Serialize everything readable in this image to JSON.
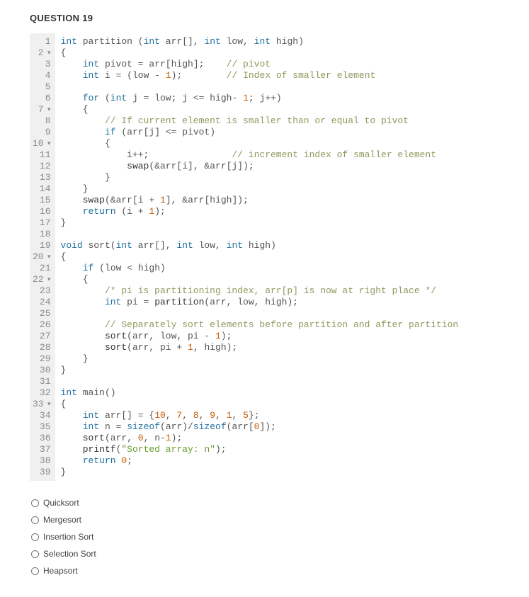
{
  "question": {
    "title": "QUESTION 19"
  },
  "code": {
    "lines": [
      {
        "n": "1",
        "fold": "",
        "tokens": [
          [
            "kw",
            "int"
          ],
          [
            "id",
            " partition "
          ],
          [
            "op",
            "("
          ],
          [
            "kw",
            "int"
          ],
          [
            "id",
            " arr"
          ],
          [
            "op",
            "[], "
          ],
          [
            "kw",
            "int"
          ],
          [
            "id",
            " low"
          ],
          [
            "op",
            ", "
          ],
          [
            "kw",
            "int"
          ],
          [
            "id",
            " high"
          ],
          [
            "op",
            ")"
          ]
        ]
      },
      {
        "n": "2",
        "fold": "▾",
        "tokens": [
          [
            "op",
            "{"
          ]
        ]
      },
      {
        "n": "3",
        "fold": "",
        "tokens": [
          [
            "id",
            "    "
          ],
          [
            "kw",
            "int"
          ],
          [
            "id",
            " pivot "
          ],
          [
            "op",
            "="
          ],
          [
            "id",
            " arr"
          ],
          [
            "op",
            "["
          ],
          [
            "id",
            "high"
          ],
          [
            "op",
            "];    "
          ],
          [
            "cmt",
            "// pivot"
          ]
        ]
      },
      {
        "n": "4",
        "fold": "",
        "tokens": [
          [
            "id",
            "    "
          ],
          [
            "kw",
            "int"
          ],
          [
            "id",
            " i "
          ],
          [
            "op",
            "="
          ],
          [
            "id",
            " "
          ],
          [
            "op",
            "("
          ],
          [
            "id",
            "low "
          ],
          [
            "op",
            "-"
          ],
          [
            "id",
            " "
          ],
          [
            "num",
            "1"
          ],
          [
            "op",
            ");        "
          ],
          [
            "cmt",
            "// Index of smaller element"
          ]
        ]
      },
      {
        "n": "5",
        "fold": "",
        "tokens": []
      },
      {
        "n": "6",
        "fold": "",
        "tokens": [
          [
            "id",
            "    "
          ],
          [
            "kw",
            "for"
          ],
          [
            "id",
            " "
          ],
          [
            "op",
            "("
          ],
          [
            "kw",
            "int"
          ],
          [
            "id",
            " j "
          ],
          [
            "op",
            "="
          ],
          [
            "id",
            " low"
          ],
          [
            "op",
            ";"
          ],
          [
            "id",
            " j "
          ],
          [
            "op",
            "<="
          ],
          [
            "id",
            " high"
          ],
          [
            "op",
            "-"
          ],
          [
            "id",
            " "
          ],
          [
            "num",
            "1"
          ],
          [
            "op",
            ";"
          ],
          [
            "id",
            " j"
          ],
          [
            "op",
            "++)"
          ]
        ]
      },
      {
        "n": "7",
        "fold": "▾",
        "tokens": [
          [
            "id",
            "    "
          ],
          [
            "op",
            "{"
          ]
        ]
      },
      {
        "n": "8",
        "fold": "",
        "tokens": [
          [
            "id",
            "        "
          ],
          [
            "cmt",
            "// If current element is smaller than or equal to pivot"
          ]
        ]
      },
      {
        "n": "9",
        "fold": "",
        "tokens": [
          [
            "id",
            "        "
          ],
          [
            "kw",
            "if"
          ],
          [
            "id",
            " "
          ],
          [
            "op",
            "("
          ],
          [
            "id",
            "arr"
          ],
          [
            "op",
            "["
          ],
          [
            "id",
            "j"
          ],
          [
            "op",
            "] "
          ],
          [
            "op",
            "<="
          ],
          [
            "id",
            " pivot"
          ],
          [
            "op",
            ")"
          ]
        ]
      },
      {
        "n": "10",
        "fold": "▾",
        "tokens": [
          [
            "id",
            "        "
          ],
          [
            "op",
            "{"
          ]
        ]
      },
      {
        "n": "11",
        "fold": "",
        "tokens": [
          [
            "id",
            "            i"
          ],
          [
            "op",
            "++;               "
          ],
          [
            "cmt",
            "// increment index of smaller element"
          ]
        ]
      },
      {
        "n": "12",
        "fold": "",
        "tokens": [
          [
            "id",
            "            "
          ],
          [
            "fn",
            "swap"
          ],
          [
            "op",
            "(&"
          ],
          [
            "id",
            "arr"
          ],
          [
            "op",
            "["
          ],
          [
            "id",
            "i"
          ],
          [
            "op",
            "], &"
          ],
          [
            "id",
            "arr"
          ],
          [
            "op",
            "["
          ],
          [
            "id",
            "j"
          ],
          [
            "op",
            "]);"
          ]
        ]
      },
      {
        "n": "13",
        "fold": "",
        "tokens": [
          [
            "id",
            "        "
          ],
          [
            "op",
            "}"
          ]
        ]
      },
      {
        "n": "14",
        "fold": "",
        "tokens": [
          [
            "id",
            "    "
          ],
          [
            "op",
            "}"
          ]
        ]
      },
      {
        "n": "15",
        "fold": "",
        "tokens": [
          [
            "id",
            "    "
          ],
          [
            "fn",
            "swap"
          ],
          [
            "op",
            "(&"
          ],
          [
            "id",
            "arr"
          ],
          [
            "op",
            "["
          ],
          [
            "id",
            "i "
          ],
          [
            "op",
            "+"
          ],
          [
            "id",
            " "
          ],
          [
            "num",
            "1"
          ],
          [
            "op",
            "], &"
          ],
          [
            "id",
            "arr"
          ],
          [
            "op",
            "["
          ],
          [
            "id",
            "high"
          ],
          [
            "op",
            "]);"
          ]
        ]
      },
      {
        "n": "16",
        "fold": "",
        "tokens": [
          [
            "id",
            "    "
          ],
          [
            "kw",
            "return"
          ],
          [
            "id",
            " "
          ],
          [
            "op",
            "("
          ],
          [
            "id",
            "i "
          ],
          [
            "op",
            "+"
          ],
          [
            "id",
            " "
          ],
          [
            "num",
            "1"
          ],
          [
            "op",
            ");"
          ]
        ]
      },
      {
        "n": "17",
        "fold": "",
        "tokens": [
          [
            "op",
            "}"
          ]
        ]
      },
      {
        "n": "18",
        "fold": "",
        "tokens": []
      },
      {
        "n": "19",
        "fold": "",
        "tokens": [
          [
            "kw",
            "void"
          ],
          [
            "id",
            " sort"
          ],
          [
            "op",
            "("
          ],
          [
            "kw",
            "int"
          ],
          [
            "id",
            " arr"
          ],
          [
            "op",
            "[], "
          ],
          [
            "kw",
            "int"
          ],
          [
            "id",
            " low"
          ],
          [
            "op",
            ", "
          ],
          [
            "kw",
            "int"
          ],
          [
            "id",
            " high"
          ],
          [
            "op",
            ")"
          ]
        ]
      },
      {
        "n": "20",
        "fold": "▾",
        "tokens": [
          [
            "op",
            "{"
          ]
        ]
      },
      {
        "n": "21",
        "fold": "",
        "tokens": [
          [
            "id",
            "    "
          ],
          [
            "kw",
            "if"
          ],
          [
            "id",
            " "
          ],
          [
            "op",
            "("
          ],
          [
            "id",
            "low "
          ],
          [
            "op",
            "<"
          ],
          [
            "id",
            " high"
          ],
          [
            "op",
            ")"
          ]
        ]
      },
      {
        "n": "22",
        "fold": "▾",
        "tokens": [
          [
            "id",
            "    "
          ],
          [
            "op",
            "{"
          ]
        ]
      },
      {
        "n": "23",
        "fold": "",
        "tokens": [
          [
            "id",
            "        "
          ],
          [
            "cmt",
            "/* pi is partitioning index, arr[p] is now at right place */"
          ]
        ]
      },
      {
        "n": "24",
        "fold": "",
        "tokens": [
          [
            "id",
            "        "
          ],
          [
            "kw",
            "int"
          ],
          [
            "id",
            " pi "
          ],
          [
            "op",
            "="
          ],
          [
            "id",
            " "
          ],
          [
            "fn",
            "partition"
          ],
          [
            "op",
            "("
          ],
          [
            "id",
            "arr"
          ],
          [
            "op",
            ", "
          ],
          [
            "id",
            "low"
          ],
          [
            "op",
            ", "
          ],
          [
            "id",
            "high"
          ],
          [
            "op",
            ");"
          ]
        ]
      },
      {
        "n": "25",
        "fold": "",
        "tokens": []
      },
      {
        "n": "26",
        "fold": "",
        "tokens": [
          [
            "id",
            "        "
          ],
          [
            "cmt",
            "// Separately sort elements before partition and after partition"
          ]
        ]
      },
      {
        "n": "27",
        "fold": "",
        "tokens": [
          [
            "id",
            "        "
          ],
          [
            "fn",
            "sort"
          ],
          [
            "op",
            "("
          ],
          [
            "id",
            "arr"
          ],
          [
            "op",
            ", "
          ],
          [
            "id",
            "low"
          ],
          [
            "op",
            ", "
          ],
          [
            "id",
            "pi "
          ],
          [
            "op",
            "-"
          ],
          [
            "id",
            " "
          ],
          [
            "num",
            "1"
          ],
          [
            "op",
            ");"
          ]
        ]
      },
      {
        "n": "28",
        "fold": "",
        "tokens": [
          [
            "id",
            "        "
          ],
          [
            "fn",
            "sort"
          ],
          [
            "op",
            "("
          ],
          [
            "id",
            "arr"
          ],
          [
            "op",
            ", "
          ],
          [
            "id",
            "pi "
          ],
          [
            "op",
            "+"
          ],
          [
            "id",
            " "
          ],
          [
            "num",
            "1"
          ],
          [
            "op",
            ", "
          ],
          [
            "id",
            "high"
          ],
          [
            "op",
            ");"
          ]
        ]
      },
      {
        "n": "29",
        "fold": "",
        "tokens": [
          [
            "id",
            "    "
          ],
          [
            "op",
            "}"
          ]
        ]
      },
      {
        "n": "30",
        "fold": "",
        "tokens": [
          [
            "op",
            "}"
          ]
        ]
      },
      {
        "n": "31",
        "fold": "",
        "tokens": []
      },
      {
        "n": "32",
        "fold": "",
        "tokens": [
          [
            "kw",
            "int"
          ],
          [
            "id",
            " main"
          ],
          [
            "op",
            "()"
          ]
        ]
      },
      {
        "n": "33",
        "fold": "▾",
        "tokens": [
          [
            "op",
            "{"
          ]
        ]
      },
      {
        "n": "34",
        "fold": "",
        "tokens": [
          [
            "id",
            "    "
          ],
          [
            "kw",
            "int"
          ],
          [
            "id",
            " arr"
          ],
          [
            "op",
            "[] = {"
          ],
          [
            "num",
            "10"
          ],
          [
            "op",
            ", "
          ],
          [
            "num",
            "7"
          ],
          [
            "op",
            ", "
          ],
          [
            "num",
            "8"
          ],
          [
            "op",
            ", "
          ],
          [
            "num",
            "9"
          ],
          [
            "op",
            ", "
          ],
          [
            "num",
            "1"
          ],
          [
            "op",
            ", "
          ],
          [
            "num",
            "5"
          ],
          [
            "op",
            "};"
          ]
        ]
      },
      {
        "n": "35",
        "fold": "",
        "tokens": [
          [
            "id",
            "    "
          ],
          [
            "kw",
            "int"
          ],
          [
            "id",
            " n "
          ],
          [
            "op",
            "="
          ],
          [
            "id",
            " "
          ],
          [
            "kw",
            "sizeof"
          ],
          [
            "op",
            "("
          ],
          [
            "id",
            "arr"
          ],
          [
            "op",
            ")/"
          ],
          [
            "kw",
            "sizeof"
          ],
          [
            "op",
            "("
          ],
          [
            "id",
            "arr"
          ],
          [
            "op",
            "["
          ],
          [
            "num",
            "0"
          ],
          [
            "op",
            "]);"
          ]
        ]
      },
      {
        "n": "36",
        "fold": "",
        "tokens": [
          [
            "id",
            "    "
          ],
          [
            "fn",
            "sort"
          ],
          [
            "op",
            "("
          ],
          [
            "id",
            "arr"
          ],
          [
            "op",
            ", "
          ],
          [
            "num",
            "0"
          ],
          [
            "op",
            ", "
          ],
          [
            "id",
            "n"
          ],
          [
            "op",
            "-"
          ],
          [
            "num",
            "1"
          ],
          [
            "op",
            ");"
          ]
        ]
      },
      {
        "n": "37",
        "fold": "",
        "tokens": [
          [
            "id",
            "    "
          ],
          [
            "fn",
            "printf"
          ],
          [
            "op",
            "("
          ],
          [
            "str",
            "\"Sorted array: n\""
          ],
          [
            "op",
            ");"
          ]
        ]
      },
      {
        "n": "38",
        "fold": "",
        "tokens": [
          [
            "id",
            "    "
          ],
          [
            "kw",
            "return"
          ],
          [
            "id",
            " "
          ],
          [
            "num",
            "0"
          ],
          [
            "op",
            ";"
          ]
        ]
      },
      {
        "n": "39",
        "fold": "",
        "tokens": [
          [
            "op",
            "}"
          ]
        ]
      }
    ]
  },
  "options": [
    {
      "label": "Quicksort"
    },
    {
      "label": "Mergesort"
    },
    {
      "label": "Insertion Sort"
    },
    {
      "label": "Selection Sort"
    },
    {
      "label": "Heapsort"
    }
  ]
}
